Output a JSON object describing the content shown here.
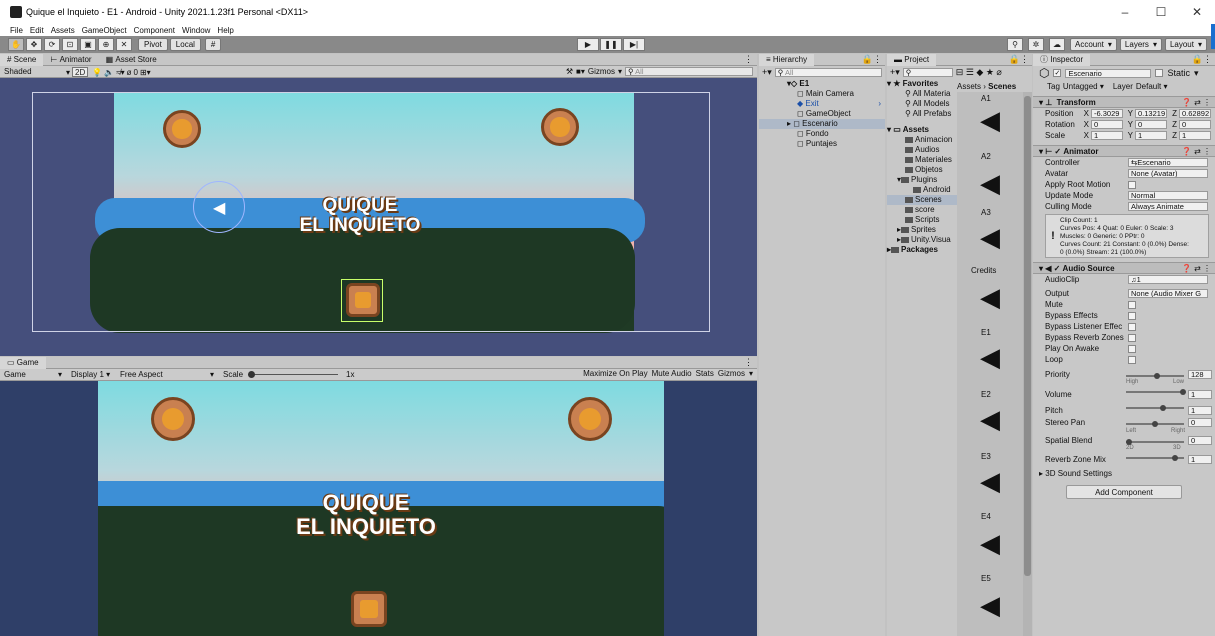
{
  "window": {
    "title": "Quique el Inquieto - E1 - Android - Unity 2021.1.23f1 Personal <DX11>",
    "controls": [
      "–",
      "☐",
      "✕"
    ]
  },
  "menu": [
    "File",
    "Edit",
    "Assets",
    "GameObject",
    "Component",
    "Window",
    "Help"
  ],
  "toolbar": {
    "pivot_label": "Pivot",
    "local_label": "Local",
    "account_label": "Account",
    "layers_label": "Layers",
    "layout_label": "Layout"
  },
  "scene": {
    "tabs": [
      "Scene",
      "Animator",
      "Asset Store"
    ],
    "shading": "Shaded",
    "mode_2d": "2D",
    "gizmos_label": "Gizmos",
    "search_placeholder": "All",
    "fx_count": "0"
  },
  "game_view": {
    "tab": "Game",
    "view_label": "Game",
    "display": "Display 1",
    "aspect": "Free Aspect",
    "scale_label": "Scale",
    "scale_value": "1x",
    "maximize_label": "Maximize On Play",
    "mute_label": "Mute Audio",
    "stats_label": "Stats",
    "gizmos_label": "Gizmos"
  },
  "game_logo": {
    "line1": "QUIQUE",
    "line2": "EL INQUIETO"
  },
  "hierarchy": {
    "tab": "Hierarchy",
    "search_placeholder": "All",
    "root": "E1",
    "items": [
      "Main Camera",
      "Exit",
      "GameObject",
      "Escenario",
      "Fondo",
      "Puntajes"
    ]
  },
  "project": {
    "tab": "Project",
    "favorites_label": "Favorites",
    "favorites": [
      "All Materia",
      "All Models",
      "All Prefabs"
    ],
    "assets_label": "Assets",
    "folders": [
      "Animacion",
      "Audios",
      "Materiales",
      "Objetos",
      "Plugins",
      "Android",
      "Scenes",
      "score",
      "Scripts",
      "Sprites",
      "Unity.Visua"
    ],
    "packages_label": "Packages",
    "breadcrumb_root": "Assets",
    "breadcrumb_current": "Scenes",
    "scenes": [
      "A1",
      "A2",
      "A3",
      "Credits",
      "E1",
      "E2",
      "E3",
      "E4",
      "E5"
    ]
  },
  "inspector": {
    "tab": "Inspector",
    "object_name": "Escenario",
    "static_label": "Static",
    "tag_label": "Tag",
    "tag_value": "Untagged",
    "layer_label": "Layer",
    "layer_value": "Default",
    "transform": {
      "title": "Transform",
      "position_label": "Position",
      "rotation_label": "Rotation",
      "scale_label": "Scale",
      "position": {
        "x": "-6.3029",
        "y": "0.13219",
        "z": "0.62892"
      },
      "rotation": {
        "x": "0",
        "y": "0",
        "z": "0"
      },
      "scale": {
        "x": "1",
        "y": "1",
        "z": "1"
      }
    },
    "animator": {
      "title": "Animator",
      "controller_label": "Controller",
      "controller_value": "Escenario",
      "avatar_label": "Avatar",
      "avatar_value": "None (Avatar)",
      "root_motion_label": "Apply Root Motion",
      "update_mode_label": "Update Mode",
      "update_mode_value": "Normal",
      "culling_mode_label": "Culling Mode",
      "culling_mode_value": "Always Animate",
      "info": [
        "Clip Count: 1",
        "Curves Pos: 4 Quat: 0 Euler: 0 Scale: 3",
        "Muscles: 0 Generic: 0 PPtr: 0",
        "Curves Count: 21 Constant: 0 (0.0%) Dense:",
        "0 (0.0%) Stream: 21 (100.0%)"
      ]
    },
    "audio_source": {
      "title": "Audio Source",
      "audioclip_label": "AudioClip",
      "audioclip_value": "1",
      "output_label": "Output",
      "output_value": "None (Audio Mixer G",
      "mute_label": "Mute",
      "bypass_effects_label": "Bypass Effects",
      "bypass_listener_label": "Bypass Listener Effec",
      "bypass_reverb_label": "Bypass Reverb Zones",
      "play_on_awake_label": "Play On Awake",
      "loop_label": "Loop",
      "priority_label": "Priority",
      "priority_value": "128",
      "priority_high": "High",
      "priority_low": "Low",
      "volume_label": "Volume",
      "volume_value": "1",
      "pitch_label": "Pitch",
      "pitch_value": "1",
      "stereo_pan_label": "Stereo Pan",
      "stereo_pan_value": "0",
      "stereo_left": "Left",
      "stereo_right": "Right",
      "spatial_blend_label": "Spatial Blend",
      "spatial_blend_value": "0",
      "spatial_2d": "2D",
      "spatial_3d": "3D",
      "reverb_mix_label": "Reverb Zone Mix",
      "reverb_mix_value": "1",
      "sound_settings_label": "3D Sound Settings"
    },
    "add_component_label": "Add Component"
  }
}
